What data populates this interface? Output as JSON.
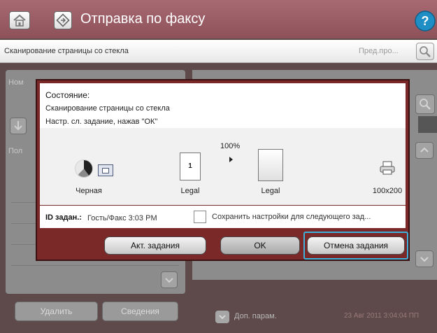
{
  "header": {
    "title": "Отправка по факсу",
    "help_label": "?"
  },
  "status_bar": {
    "message": "Сканирование страницы со стекла",
    "preview_label": "Пред.про..."
  },
  "background": {
    "list_prefix": "Ном",
    "column_prefix": "Пол",
    "delete_label": "Удалить",
    "details_label": "Сведения",
    "more_params_label": "Доп. парам.",
    "datetime": "23 Авг 2011 3:04:04 ПП"
  },
  "dialog": {
    "status_label": "Состояние:",
    "status_line1": "Сканирование страницы со стекла",
    "status_line2": "Настр. сл. задание, нажав \"ОК\"",
    "zoom_percent": "100%",
    "source_page_number": "1",
    "color_mode_label": "Черная",
    "source_size_label": "Legal",
    "output_size_label": "Legal",
    "resolution_label": "100x200",
    "job_id_label": "ID задан.:",
    "job_id_value": "Гость/Факс 3:03 PM",
    "save_settings_label": "Сохранить настройки для следующего зад...",
    "active_jobs_button": "Акт. задания",
    "ok_button": "OK",
    "cancel_job_button": "Отмена задания"
  },
  "colors": {
    "title_bar": "#95575f",
    "dialog_frame": "#7b2828",
    "focus_ring": "#3cb2dc"
  }
}
